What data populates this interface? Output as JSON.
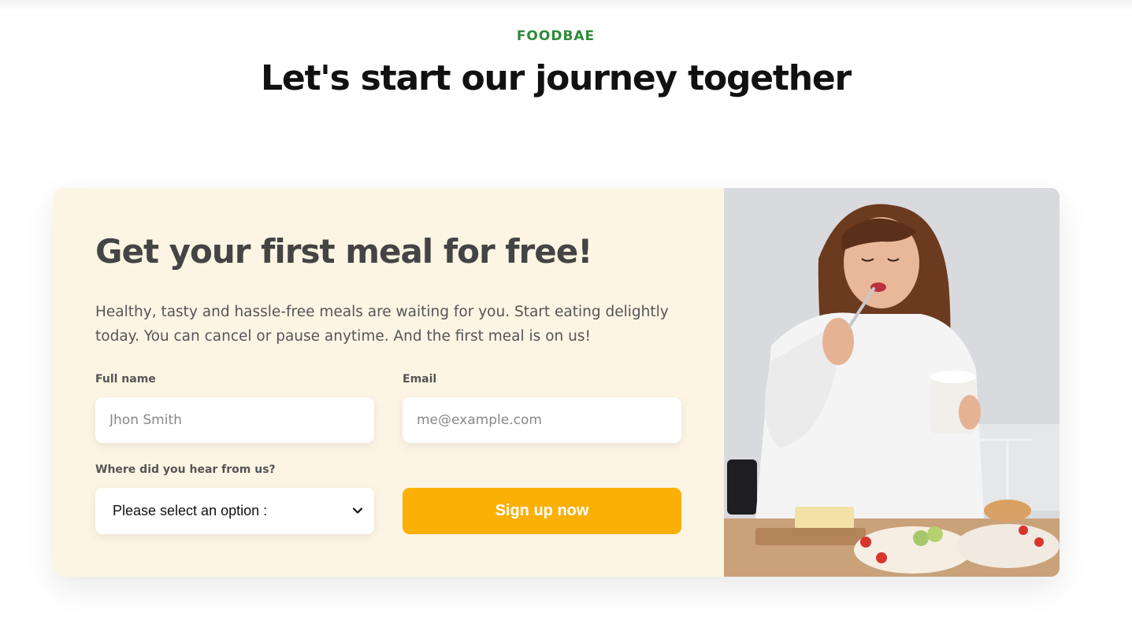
{
  "header": {
    "subheading": "FOODBAE",
    "title": "Let's start our journey together"
  },
  "cta": {
    "title": "Get your first meal for free!",
    "description": "Healthy, tasty and hassle-free meals are waiting for you. Start eating delightly today. You can cancel or pause anytime. And the first meal is on us!",
    "form": {
      "full_name": {
        "label": "Full name",
        "placeholder": "Jhon Smith"
      },
      "email": {
        "label": "Email",
        "placeholder": "me@example.com"
      },
      "source": {
        "label": "Where did you hear from us?",
        "selected": "Please select an option :"
      },
      "submit_label": "Sign up now"
    },
    "image": {
      "icon": "photo-woman-eating-icon"
    }
  },
  "colors": {
    "accent": "#2f8a3b",
    "button": "#fab005",
    "panel": "#fdf5e4",
    "heading": "#111111"
  }
}
